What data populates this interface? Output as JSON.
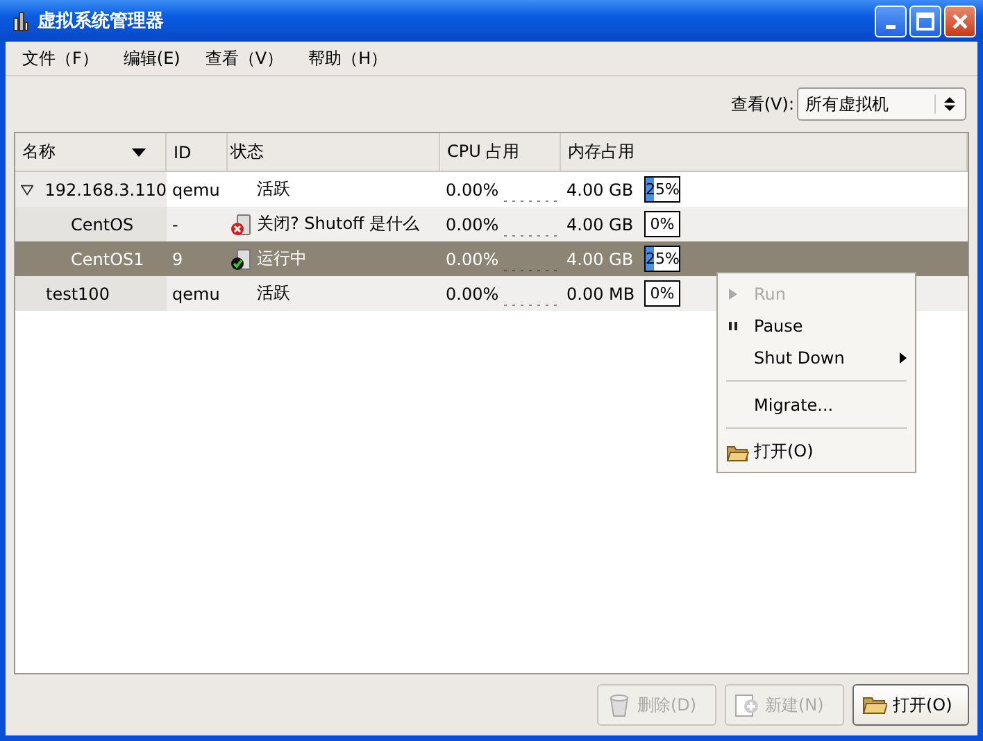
{
  "window": {
    "title": "虚拟系统管理器"
  },
  "menu": [
    "文件（F）",
    "编辑(E)",
    "查看（V）",
    "帮助（H）"
  ],
  "view_filter": {
    "label": "查看(V):",
    "value": "所有虚拟机"
  },
  "table": {
    "columns": [
      "名称",
      "ID",
      "状态",
      "CPU 占用",
      "内存占用"
    ],
    "rows": [
      {
        "kind": "host",
        "name": "192.168.3.110",
        "id": "qemu",
        "status": "活跃",
        "cpu": "0.00%",
        "memory": "4.00 GB",
        "level": 0.25,
        "mem_text": "25%",
        "selected": false,
        "expanded": true,
        "children": [
          {
            "kind": "stopped",
            "name": "CentOS",
            "id": "-",
            "status": "关闭? Shutoff 是什么",
            "cpu": "0.00%",
            "memory": "4.00 GB",
            "level": 0,
            "mem_text": "0%",
            "selected": false
          },
          {
            "kind": "running",
            "name": "CentOS1",
            "id": "9",
            "status": "运行中",
            "cpu": "0.00%",
            "memory": "4.00 GB",
            "level": 0.25,
            "mem_text": "25%",
            "selected": true
          }
        ]
      },
      {
        "kind": "host",
        "name": "test100",
        "id": "qemu",
        "status": "活跃",
        "cpu": "0.00%",
        "memory": "0.00 MB",
        "level": 0,
        "mem_text": "0%",
        "selected": false
      }
    ]
  },
  "context_menu": [
    {
      "kind": "play",
      "label": "Run",
      "disabled": true,
      "submenu": false
    },
    {
      "kind": "pause",
      "label": "Pause",
      "disabled": false,
      "submenu": false
    },
    {
      "kind": "plain",
      "label": "Shut Down",
      "disabled": false,
      "submenu": true
    },
    {
      "kind": "separator"
    },
    {
      "kind": "plain",
      "label": "Migrate...",
      "disabled": false,
      "submenu": false
    },
    {
      "kind": "separator"
    },
    {
      "kind": "folder",
      "label": "打开(O)",
      "disabled": false,
      "submenu": false
    }
  ],
  "buttons": [
    {
      "kind": "trash",
      "label": "删除(D)",
      "disabled": true
    },
    {
      "kind": "new",
      "label": "新建(N)",
      "disabled": true
    },
    {
      "kind": "folder",
      "label": "打开(O)",
      "disabled": false
    }
  ]
}
